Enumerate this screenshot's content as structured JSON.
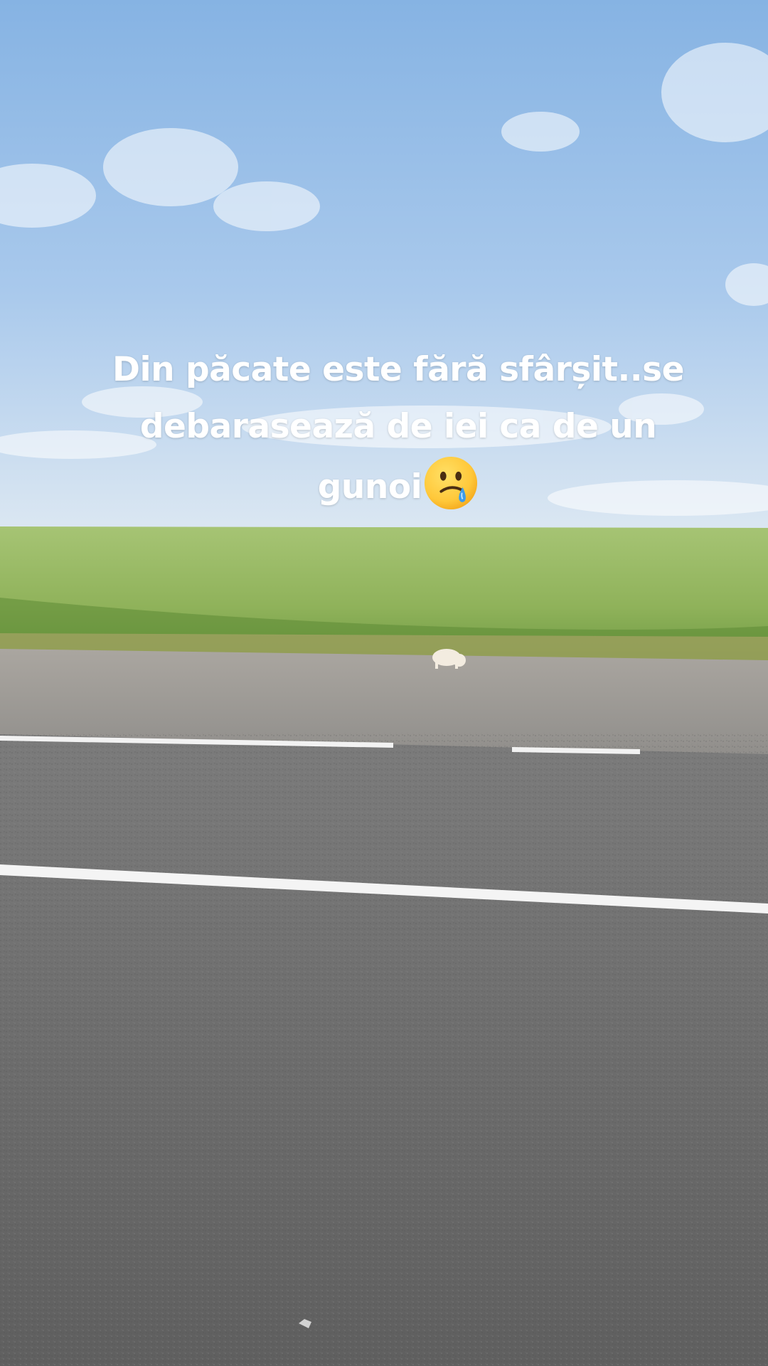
{
  "overlay": {
    "caption": "Din păcate este fără sfârșit..se debarasează de iei ca de un gunoi",
    "emoji": "face-holding-back-tears-icon"
  },
  "colors": {
    "sky_top": "#8fb9e6",
    "sky_bottom": "#d9e6f2",
    "field": "#8fb25a",
    "gravel": "#9d9a95",
    "asphalt": "#6e6e6e",
    "lane_marking": "#f4f4f4",
    "caption_text": "#ffffff"
  }
}
